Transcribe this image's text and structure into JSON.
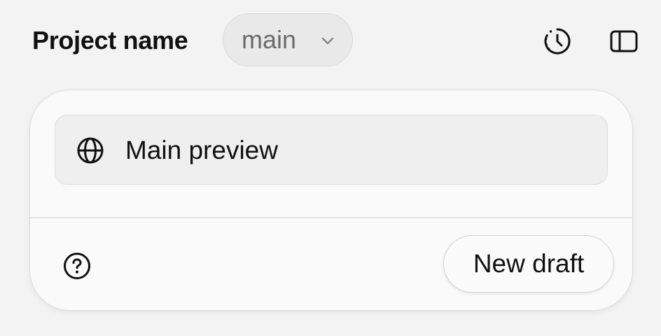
{
  "header": {
    "project_title": "Project name",
    "branch": {
      "label": "main",
      "icon": "chevron-down-icon"
    },
    "actions": [
      {
        "name": "history",
        "icon": "history-icon"
      },
      {
        "name": "toggle-sidebar",
        "icon": "sidebar-icon"
      }
    ]
  },
  "card": {
    "preview": {
      "label": "Main preview",
      "icon": "globe-icon"
    },
    "footer": {
      "help_icon": "help-icon",
      "new_draft_label": "New draft"
    }
  },
  "colors": {
    "background": "#f3f3f3",
    "card_background": "#fafafa",
    "pill_background": "#e9e9e9",
    "muted_text": "#6b6b6b",
    "text": "#111111"
  }
}
